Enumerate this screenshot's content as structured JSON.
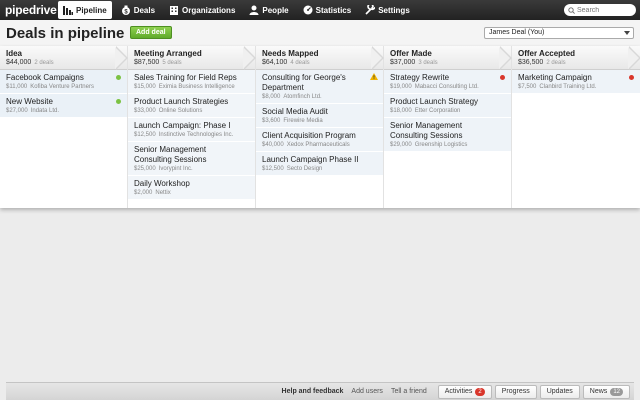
{
  "app": {
    "logo": "pipedrive",
    "nav": [
      {
        "label": "Pipeline",
        "icon": "pipeline-icon",
        "active": true
      },
      {
        "label": "Deals",
        "icon": "money-bag-icon"
      },
      {
        "label": "Organizations",
        "icon": "building-icon"
      },
      {
        "label": "People",
        "icon": "person-icon"
      },
      {
        "label": "Statistics",
        "icon": "gauge-icon"
      },
      {
        "label": "Settings",
        "icon": "wrench-icon"
      }
    ],
    "search": {
      "placeholder": "Search"
    }
  },
  "header": {
    "title": "Deals in pipeline",
    "add_deal": "Add deal",
    "user_filter": "James Deal (You)"
  },
  "colors": {
    "green": "#7cc243",
    "red": "#d9362b",
    "warning": "#f0b400",
    "accent_blue": "#eef3f8"
  },
  "stages": [
    {
      "name": "Idea",
      "total": "$44,000",
      "count": "2 deals",
      "deals": [
        {
          "title": "Facebook Campaigns",
          "value": "$11,000",
          "org": "Kofiba Venture Partners",
          "status": "green"
        },
        {
          "title": "New Website",
          "value": "$27,000",
          "org": "Indata Ltd.",
          "status": "green"
        }
      ]
    },
    {
      "name": "Meeting Arranged",
      "total": "$87,500",
      "count": "5 deals",
      "deals": [
        {
          "title": "Sales Training for Field Reps",
          "value": "$15,000",
          "org": "Eximia Business Intelligence",
          "status": ""
        },
        {
          "title": "Product Launch Strategies",
          "value": "$33,000",
          "org": "Online Solutions",
          "status": ""
        },
        {
          "title": "Launch Campaign: Phase I",
          "value": "$12,500",
          "org": "Instinctive Technologies Inc.",
          "status": ""
        },
        {
          "title": "Senior Management Consulting Sessions",
          "value": "$25,000",
          "org": "Ivorypint Inc.",
          "status": ""
        },
        {
          "title": "Daily Workshop",
          "value": "$2,000",
          "org": "Nettix",
          "status": ""
        }
      ]
    },
    {
      "name": "Needs Mapped",
      "total": "$64,100",
      "count": "4 deals",
      "deals": [
        {
          "title": "Consulting for George's Department",
          "value": "$8,000",
          "org": "Atomfinch Ltd.",
          "status": "warning"
        },
        {
          "title": "Social Media Audit",
          "value": "$3,600",
          "org": "Firewire Media",
          "status": ""
        },
        {
          "title": "Client Acquisition Program",
          "value": "$40,000",
          "org": "Xedox Pharmaceuticals",
          "status": ""
        },
        {
          "title": "Launch Campaign Phase II",
          "value": "$12,500",
          "org": "Secto Design",
          "status": ""
        }
      ]
    },
    {
      "name": "Offer Made",
      "total": "$37,000",
      "count": "3 deals",
      "deals": [
        {
          "title": "Strategy Rewrite",
          "value": "$19,000",
          "org": "Mabacci Consulting Ltd.",
          "status": "red"
        },
        {
          "title": "Product Launch Strategy",
          "value": "$18,000",
          "org": "Etter Corporation",
          "status": ""
        },
        {
          "title": "Senior Management Consulting Sessions",
          "value": "$29,000",
          "org": "Greenship Logistics",
          "status": ""
        }
      ]
    },
    {
      "name": "Offer Accepted",
      "total": "$36,500",
      "count": "2 deals",
      "deals": [
        {
          "title": "Marketing Campaign",
          "value": "$7,500",
          "org": "Clanbird Training Ltd.",
          "status": "red"
        }
      ]
    }
  ],
  "footer": {
    "help": "Help and feedback",
    "add_users": "Add users",
    "tell_friend": "Tell a friend",
    "activities": "Activities",
    "activities_count": "2",
    "progress": "Progress",
    "updates": "Updates",
    "news": "News",
    "news_count": "12"
  }
}
